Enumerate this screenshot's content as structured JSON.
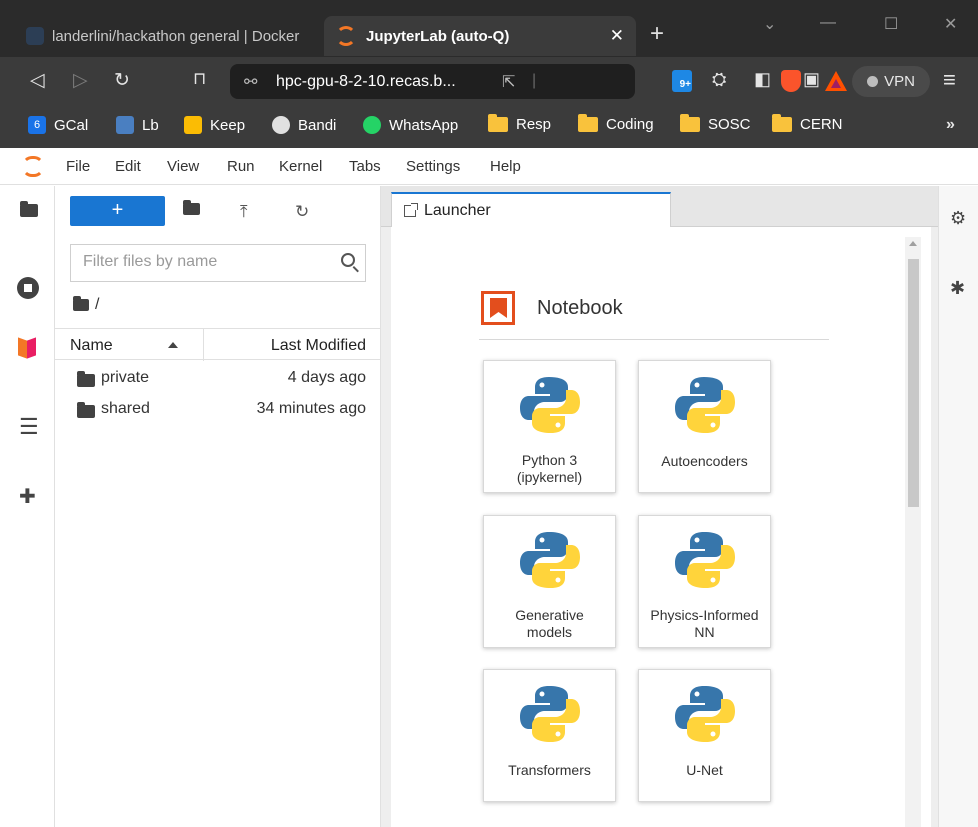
{
  "browser": {
    "tabs": [
      {
        "title": "landerlini/hackathon general | Docker",
        "active": false
      },
      {
        "title": "JupyterLab (auto-Q)",
        "active": true
      }
    ],
    "new_tab": "+",
    "window_controls": {
      "dropdown": "⌄",
      "minimize": "—",
      "maximize": "☐",
      "close": "✕"
    },
    "url": "hpc-gpu-8-2-10.recas.b...",
    "ext_badge": "9+",
    "vpn_label": "VPN",
    "bookmarks": [
      {
        "label": "GCal",
        "icon": "calendar-icon",
        "color": "#1a73e8"
      },
      {
        "label": "Lb",
        "icon": "lb-icon",
        "color": "#4a7fc1"
      },
      {
        "label": "Keep",
        "icon": "keep-icon",
        "color": "#fbbc04"
      },
      {
        "label": "Bandi",
        "icon": "globe-icon",
        "color": "#e0e0e0"
      },
      {
        "label": "WhatsApp",
        "icon": "whatsapp-icon",
        "color": "#25d366"
      },
      {
        "label": "Resp",
        "icon": "folder-icon"
      },
      {
        "label": "Coding",
        "icon": "folder-icon"
      },
      {
        "label": "SOSC",
        "icon": "folder-icon"
      },
      {
        "label": "CERN",
        "icon": "folder-icon"
      }
    ],
    "bookmarks_more": "»"
  },
  "jupyter": {
    "menu": [
      "File",
      "Edit",
      "View",
      "Run",
      "Kernel",
      "Tabs",
      "Settings",
      "Help"
    ],
    "filebrowser": {
      "new_button": "+",
      "filter_placeholder": "Filter files by name",
      "breadcrumb": "/",
      "columns": {
        "name": "Name",
        "modified": "Last Modified"
      },
      "files": [
        {
          "name": "private",
          "modified": "4 days ago"
        },
        {
          "name": "shared",
          "modified": "34 minutes ago"
        }
      ]
    },
    "launcher_tab": "Launcher",
    "section_title": "Notebook",
    "kernels": [
      {
        "label": "Python 3\n(ipykernel)"
      },
      {
        "label": "Autoencoders"
      },
      {
        "label": "Generative\nmodels"
      },
      {
        "label": "Physics-Informed\nNN"
      },
      {
        "label": "Transformers"
      },
      {
        "label": "U-Net"
      }
    ],
    "colors": {
      "accent": "#1976d2",
      "jupyter_orange": "#f37726",
      "notebook_icon": "#e34e1d",
      "python_blue": "#3776ab",
      "python_yellow": "#ffd43b"
    }
  }
}
